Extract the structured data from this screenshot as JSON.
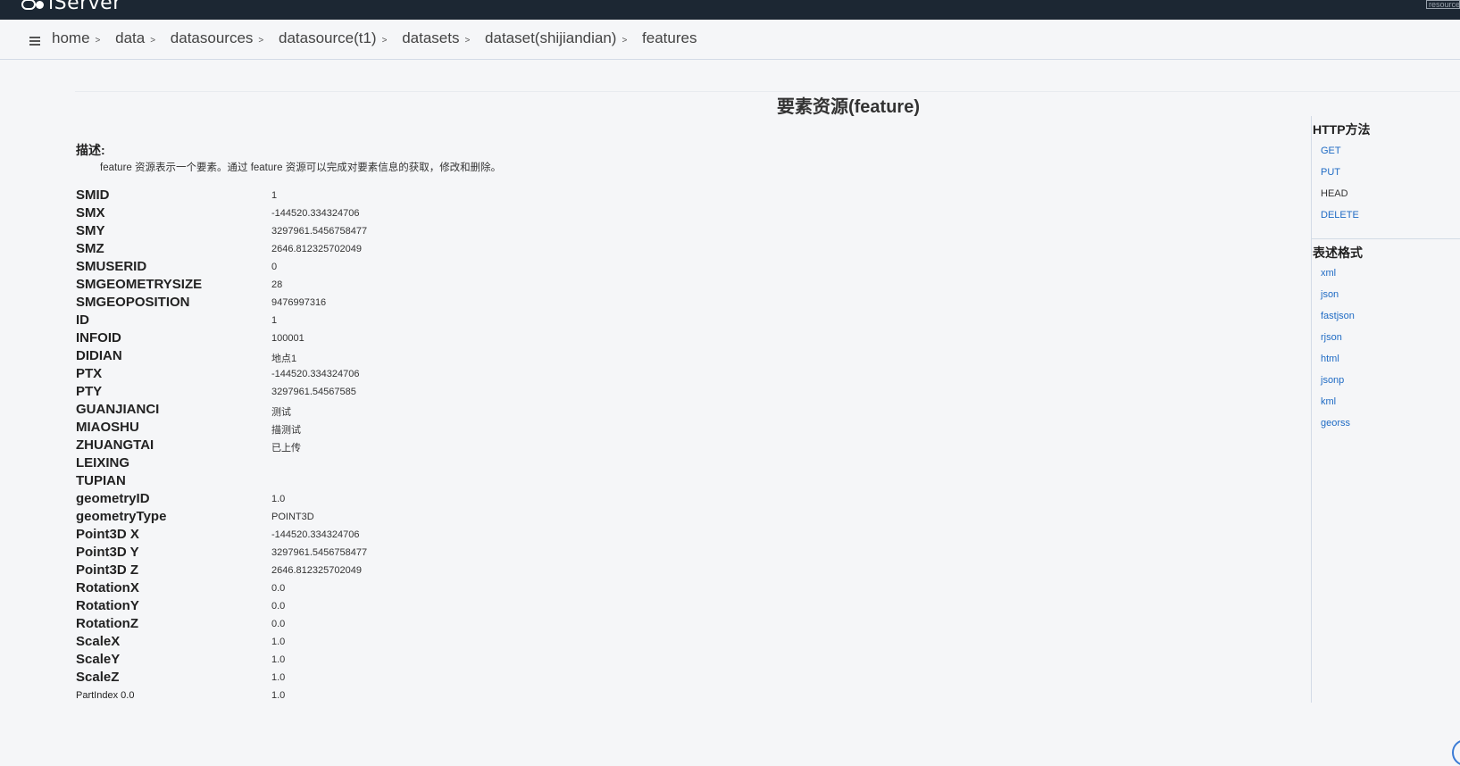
{
  "app": {
    "name": "iServer",
    "resource_label": "resource"
  },
  "breadcrumb": [
    "home",
    "data",
    "datasources",
    "datasource(t1)",
    "datasets",
    "dataset(shijiandian)",
    "features"
  ],
  "page_title": "要素资源(feature)",
  "description": {
    "label": "描述:",
    "text": "feature 资源表示一个要素。通过 feature 资源可以完成对要素信息的获取，修改和删除。"
  },
  "fields": [
    {
      "key": "SMID",
      "value": "1"
    },
    {
      "key": "SMX",
      "value": "-144520.334324706"
    },
    {
      "key": "SMY",
      "value": "3297961.5456758477"
    },
    {
      "key": "SMZ",
      "value": "2646.812325702049"
    },
    {
      "key": "SMUSERID",
      "value": "0"
    },
    {
      "key": "SMGEOMETRYSIZE",
      "value": "28"
    },
    {
      "key": "SMGEOPOSITION",
      "value": "9476997316"
    },
    {
      "key": "ID",
      "value": "1"
    },
    {
      "key": "INFOID",
      "value": "100001"
    },
    {
      "key": "DIDIAN",
      "value": "地点1"
    },
    {
      "key": "PTX",
      "value": "-144520.334324706"
    },
    {
      "key": "PTY",
      "value": "3297961.54567585"
    },
    {
      "key": "GUANJIANCI",
      "value": "测试"
    },
    {
      "key": "MIAOSHU",
      "value": "描测试"
    },
    {
      "key": "ZHUANGTAI",
      "value": "已上传"
    },
    {
      "key": "LEIXING",
      "value": ""
    },
    {
      "key": "TUPIAN",
      "value": ""
    },
    {
      "key": "geometryID",
      "value": "1.0"
    },
    {
      "key": "geometryType",
      "value": "POINT3D"
    },
    {
      "key": "Point3D X",
      "value": "-144520.334324706"
    },
    {
      "key": "Point3D Y",
      "value": "3297961.5456758477"
    },
    {
      "key": "Point3D Z",
      "value": "2646.812325702049"
    },
    {
      "key": "RotationX",
      "value": "0.0"
    },
    {
      "key": "RotationY",
      "value": "0.0"
    },
    {
      "key": "RotationZ",
      "value": "0.0"
    },
    {
      "key": "ScaleX",
      "value": "1.0"
    },
    {
      "key": "ScaleY",
      "value": "1.0"
    },
    {
      "key": "ScaleZ",
      "value": "1.0"
    },
    {
      "key": "PartIndex 0.0",
      "value": "1.0"
    }
  ],
  "sidebar": {
    "http_methods_title": "HTTP方法",
    "http_methods": [
      {
        "label": "GET",
        "link": true
      },
      {
        "label": "PUT",
        "link": true
      },
      {
        "label": "HEAD",
        "link": false
      },
      {
        "label": "DELETE",
        "link": true
      }
    ],
    "formats_title": "表述格式",
    "formats": [
      "xml",
      "json",
      "fastjson",
      "rjson",
      "html",
      "jsonp",
      "kml",
      "georss"
    ]
  }
}
